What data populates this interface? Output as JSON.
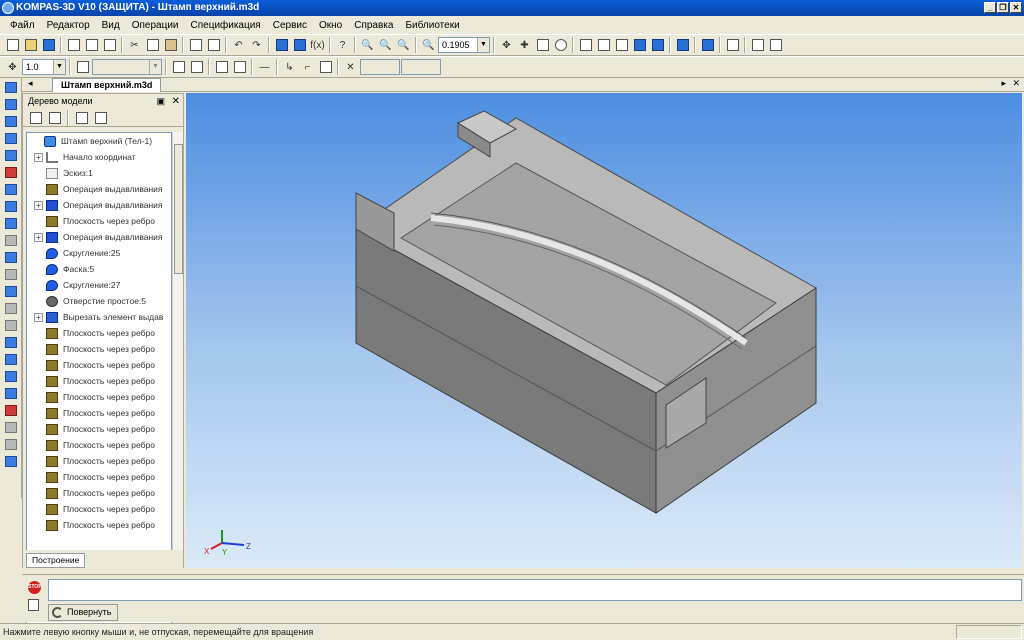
{
  "window": {
    "title": "KOMPAS-3D V10 (ЗАЩИТА) - Штамп верхний.m3d",
    "controls": [
      "_",
      "❐",
      "✕"
    ]
  },
  "menu": [
    "Файл",
    "Редактор",
    "Вид",
    "Операции",
    "Спецификация",
    "Сервис",
    "Окно",
    "Справка",
    "Библиотеки"
  ],
  "toolbar": {
    "zoom_value": "0.1905",
    "scale_value": "1.0"
  },
  "document_tab": "Штамп верхний.m3d",
  "tree": {
    "panel_title": "Дерево модели",
    "bottom_tab": "Построение",
    "items": [
      {
        "label": "Штамп верхний (Тел-1)",
        "icon": "root",
        "exp": false,
        "indent": 0
      },
      {
        "label": "Начало координат",
        "icon": "axis",
        "exp": true,
        "indent": 1
      },
      {
        "label": "Эскиз:1",
        "icon": "plane",
        "exp": false,
        "indent": 1
      },
      {
        "label": "Операция выдавливания",
        "icon": "olive",
        "exp": false,
        "indent": 1
      },
      {
        "label": "Операция выдавливания",
        "icon": "cube",
        "exp": true,
        "indent": 1
      },
      {
        "label": "Плоскость через ребро",
        "icon": "olive",
        "exp": false,
        "indent": 1
      },
      {
        "label": "Операция выдавливания",
        "icon": "cube",
        "exp": true,
        "indent": 1
      },
      {
        "label": "Скругление:25",
        "icon": "sphere",
        "exp": false,
        "indent": 1
      },
      {
        "label": "Фаска:5",
        "icon": "sphere",
        "exp": false,
        "indent": 1
      },
      {
        "label": "Скругление:27",
        "icon": "sphere",
        "exp": false,
        "indent": 1
      },
      {
        "label": "Отверстие простое:5",
        "icon": "hole",
        "exp": false,
        "indent": 1
      },
      {
        "label": "Вырезать элемент выдав",
        "icon": "arr",
        "exp": true,
        "indent": 1
      },
      {
        "label": "Плоскость через ребро",
        "icon": "olive",
        "exp": false,
        "indent": 1
      },
      {
        "label": "Плоскость через ребро",
        "icon": "olive",
        "exp": false,
        "indent": 1
      },
      {
        "label": "Плоскость через ребро",
        "icon": "olive",
        "exp": false,
        "indent": 1
      },
      {
        "label": "Плоскость через ребро",
        "icon": "olive",
        "exp": false,
        "indent": 1
      },
      {
        "label": "Плоскость через ребро",
        "icon": "olive",
        "exp": false,
        "indent": 1
      },
      {
        "label": "Плоскость через ребро",
        "icon": "olive",
        "exp": false,
        "indent": 1
      },
      {
        "label": "Плоскость через ребро",
        "icon": "olive",
        "exp": false,
        "indent": 1
      },
      {
        "label": "Плоскость через ребро",
        "icon": "olive",
        "exp": false,
        "indent": 1
      },
      {
        "label": "Плоскость через ребро",
        "icon": "olive",
        "exp": false,
        "indent": 1
      },
      {
        "label": "Плоскость через ребро",
        "icon": "olive",
        "exp": false,
        "indent": 1
      },
      {
        "label": "Плоскость через ребро",
        "icon": "olive",
        "exp": false,
        "indent": 1
      },
      {
        "label": "Плоскость через ребро",
        "icon": "olive",
        "exp": false,
        "indent": 1
      },
      {
        "label": "Плоскость через ребро",
        "icon": "olive",
        "exp": false,
        "indent": 1
      }
    ]
  },
  "viewport": {
    "axis_labels": {
      "x": "X",
      "y": "Y",
      "z": "Z"
    }
  },
  "properties": {
    "button_label": "Повернуть"
  },
  "status": {
    "text": "Нажмите левую кнопку мыши и, не отпуская, перемещайте для вращения"
  }
}
